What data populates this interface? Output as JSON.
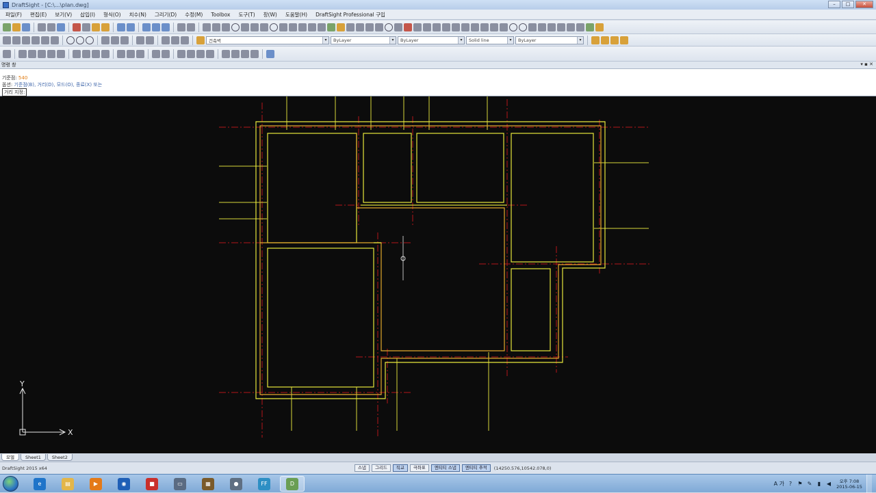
{
  "window": {
    "title": "DraftSight - [C:\\...\\plan.dwg]",
    "minimize": "–",
    "maximize": "□",
    "close": "✕"
  },
  "menu": [
    "파일(F)",
    "편집(E)",
    "보기(V)",
    "삽입(I)",
    "형식(O)",
    "치수(N)",
    "그리기(D)",
    "수정(M)",
    "Toolbox",
    "도구(T)",
    "창(W)",
    "도움말(H)",
    "DraftSight Professional 구입"
  ],
  "toolbar": {
    "layer_combo": "건축벽",
    "color_combo": "ByLayer",
    "linestyle_combo": "ByLayer",
    "lineweight_combo": "Solid line",
    "layer2_combo": "ByLayer"
  },
  "command_panel": {
    "title": "명령 창",
    "controls": "▾ ▪ ✕",
    "line1_prefix": "기준점:",
    "line1_value": "540",
    "line2_prefix": "옵션:",
    "line2_text": "기준점(B), 거리(D), 모드(O), 종료(X) 또는",
    "line3_prompt": "거리 지정:"
  },
  "ucs": {
    "x": "X",
    "y": "Y"
  },
  "sheet_tabs": [
    "모델",
    "Sheet1",
    "Sheet2"
  ],
  "status": {
    "app_name": "DraftSight 2015 x64",
    "buttons": [
      {
        "label": "스냅",
        "on": false
      },
      {
        "label": "그리드",
        "on": false
      },
      {
        "label": "직교",
        "on": true
      },
      {
        "label": "극좌표",
        "on": false
      },
      {
        "label": "엔티티 스냅",
        "on": true
      },
      {
        "label": "엔티티 추적",
        "on": true
      }
    ],
    "coordinates": "(14250.576,10542.078,0)"
  },
  "taskbar": {
    "apps": [
      {
        "name": "internet-explorer",
        "glyph": "e",
        "color": "#1f74c9",
        "active": false
      },
      {
        "name": "file-explorer",
        "glyph": "▤",
        "color": "#e3b64a",
        "active": false
      },
      {
        "name": "media-player",
        "glyph": "▶",
        "color": "#e47a18",
        "active": false
      },
      {
        "name": "browser-globe",
        "glyph": "◉",
        "color": "#1f5fb6",
        "active": false
      },
      {
        "name": "video-app",
        "glyph": "■",
        "color": "#c9302c",
        "active": false
      },
      {
        "name": "monitor-app",
        "glyph": "▭",
        "color": "#5a6b82",
        "active": false
      },
      {
        "name": "archive-app",
        "glyph": "▦",
        "color": "#7a5a2a",
        "active": false
      },
      {
        "name": "globe-app",
        "glyph": "●",
        "color": "#5f6f82",
        "active": false
      },
      {
        "name": "ff-app",
        "glyph": "FF",
        "color": "#2d8fc4",
        "active": false
      },
      {
        "name": "draftsight-app",
        "glyph": "D",
        "color": "#6a9e54",
        "active": true
      }
    ],
    "tray_lang": "A 가",
    "clock_time": "오후 7:08",
    "clock_date": "2015-06-15"
  },
  "colors": {
    "canvas": "#0c0c0c",
    "wall": "#e8e83c",
    "wall_orange": "#e3a82c",
    "center": "#d42020"
  }
}
